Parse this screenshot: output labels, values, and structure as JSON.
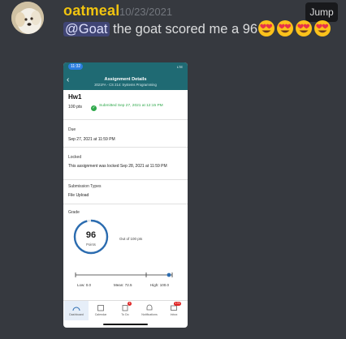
{
  "message": {
    "username": "oatmeal",
    "timestamp": "10/23/2021",
    "jump_label": "Jump",
    "mention": "@Goat",
    "text": " the goat scored me a 96",
    "emoji_name": "heart-eyes-emoji",
    "emoji_count": 4
  },
  "colors": {
    "background": "#36393f",
    "username": "#f1c40f",
    "mention_bg": "#5865f24d",
    "app_header": "#1f6a73",
    "success": "#2ea84a"
  },
  "phone": {
    "status_time": "11:32",
    "status_signal": "LTE",
    "header_title": "Assignment Details",
    "header_subtitle": "2021FA - CS 214: Systems Programming",
    "assignment_name": "Hw1",
    "points": "100 pts",
    "submitted": "Submitted Sep 27, 2021 at 12:15 PM",
    "due_label": "Due",
    "due_value": "Sep 27, 2021 at 11:59 PM",
    "locked_label": "Locked",
    "locked_value": "This assignment was locked Sep 28, 2021 at 11:59 PM",
    "submission_types_label": "Submission Types",
    "submission_types_value": "File Upload",
    "grade_label": "Grade",
    "score": "96",
    "score_unit": "Points",
    "out_of": "Out of 100 pts",
    "score_fraction": 0.96,
    "stats": {
      "low": "Low: 0.0",
      "mean": "Mean: 72.5",
      "high": "High: 100.0"
    },
    "tabs": [
      {
        "label": "Dashboard",
        "active": true
      },
      {
        "label": "Calendar",
        "active": false
      },
      {
        "label": "To Do",
        "active": false,
        "badge": "4"
      },
      {
        "label": "Notifications",
        "active": false
      },
      {
        "label": "Inbox",
        "active": false,
        "badge": "176"
      }
    ]
  }
}
